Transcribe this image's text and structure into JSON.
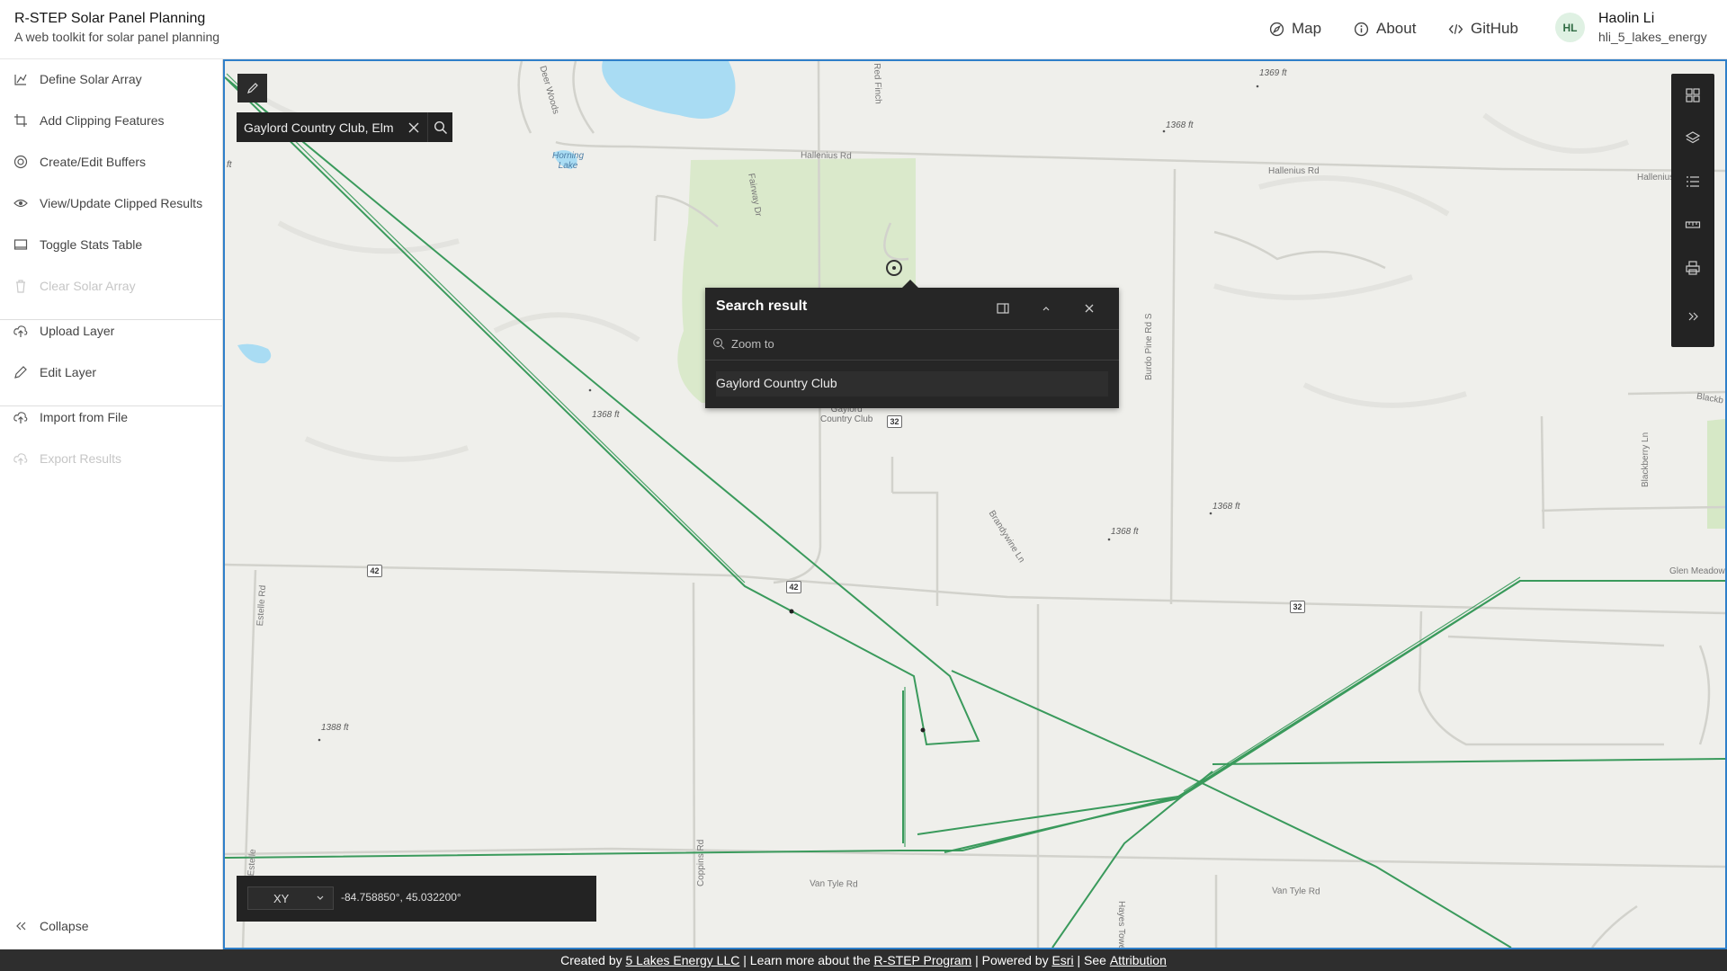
{
  "header": {
    "title": "R-STEP Solar Panel Planning",
    "subtitle": "A web toolkit for solar panel planning",
    "nav": [
      {
        "label": "Map",
        "icon": "compass-icon"
      },
      {
        "label": "About",
        "icon": "info-icon"
      },
      {
        "label": "GitHub",
        "icon": "code-icon"
      }
    ],
    "user": {
      "initials": "HL",
      "name": "Haolin Li",
      "handle": "hli_5_lakes_energy"
    }
  },
  "sidebar": {
    "items": [
      {
        "label": "Define Solar Array",
        "icon": "define-array-icon",
        "enabled": true
      },
      {
        "label": "Add Clipping Features",
        "icon": "crop-icon",
        "enabled": true
      },
      {
        "label": "Create/Edit Buffers",
        "icon": "buffer-icon",
        "enabled": true
      },
      {
        "label": "View/Update Clipped Results",
        "icon": "eye-icon",
        "enabled": true
      },
      {
        "label": "Toggle Stats Table",
        "icon": "table-icon",
        "enabled": true
      },
      {
        "label": "Clear Solar Array",
        "icon": "trash-icon",
        "enabled": false
      },
      {
        "label": "Upload Layer",
        "icon": "upload-icon",
        "enabled": true
      },
      {
        "label": "Edit Layer",
        "icon": "pencil-icon",
        "enabled": true
      },
      {
        "label": "Import from File",
        "icon": "import-icon",
        "enabled": true
      },
      {
        "label": "Export Results",
        "icon": "export-icon",
        "enabled": false
      }
    ],
    "collapse_label": "Collapse"
  },
  "map": {
    "search": {
      "value": "Gaylord Country Club, Elm"
    },
    "popup": {
      "title": "Search result",
      "zoom_to": "Zoom to",
      "result": "Gaylord Country Club"
    },
    "labels": {
      "horning_lake": "Horning\nLake",
      "country_club": "Gaylord\nCountry Club",
      "hallenius_1": "Hallenius Rd",
      "hallenius_2": "Hallenius Rd",
      "hallenius_3": "Hallenius",
      "burdo_pine": "Burdo Pine Rd S",
      "brandywine": "Brandywine Ln",
      "blackberry": "Blackberry Ln",
      "blackb": "Blackb",
      "glen_meadow": "Glen Meadow",
      "estelle_1": "Estelle Rd",
      "estelle_2": "Estelle",
      "coppins": "Coppins Rd",
      "hayes_tower": "Hayes Tower Rd",
      "van_tyle_1": "Van Tyle Rd",
      "van_tyle_2": "Van Tyle Rd",
      "fairway": "Fairway Dr",
      "red_finch": "Red Finch",
      "deer_woods": "Deer Woods"
    },
    "elevations": [
      "1369 ft",
      "1368 ft",
      "1368 ft",
      "1368 ft",
      "1368 ft",
      "1388 ft",
      "ft"
    ],
    "shields": [
      "42",
      "42",
      "32",
      "32"
    ],
    "coordinates": {
      "format": "XY",
      "value": "-84.758850°, 45.032200°"
    },
    "toolbar": [
      "basemap-gallery-icon",
      "layers-icon",
      "legend-icon",
      "measure-icon",
      "print-icon",
      "expand-icon"
    ],
    "colors": {
      "line": "#3a9a5c",
      "water": "#a9dcf3",
      "park": "#d6e8c6",
      "frame": "#2f7fc9"
    }
  },
  "footer": {
    "created_by": "Created by ",
    "company": "5 Lakes Energy LLC",
    "sep1": " | ",
    "learn_more": "Learn more about the ",
    "program": "R-STEP Program",
    "sep2": " | ",
    "powered_by": "Powered by ",
    "esri": "Esri",
    "sep3": " | ",
    "see": "See ",
    "attribution": "Attribution"
  }
}
